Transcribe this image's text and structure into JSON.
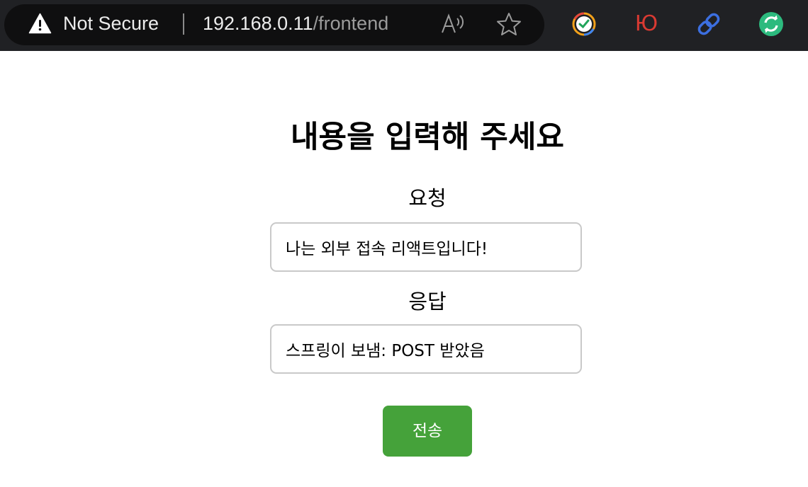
{
  "browser": {
    "security_label": "Not Secure",
    "url_host": "192.168.0.11",
    "url_path": "/frontend",
    "icons": {
      "security": "warning-triangle-icon",
      "read_aloud": "read-aloud-icon",
      "favorite": "star-icon"
    },
    "extensions": [
      {
        "name": "clock-extension-icon"
      },
      {
        "name": "yu-extension-icon",
        "text": "Ю",
        "color": "#d93a32"
      },
      {
        "name": "link-extension-icon",
        "color": "#3c6fe0"
      },
      {
        "name": "refresh-extension-icon",
        "color": "#2cba7e"
      }
    ]
  },
  "form": {
    "heading": "내용을 입력해 주세요",
    "request_label": "요청",
    "request_value": "나는 외부 접속 리액트입니다!",
    "response_label": "응답",
    "response_value": "스프링이 보냄: POST 받았음",
    "submit_label": "전송"
  },
  "colors": {
    "toolbar_background": "#202124",
    "omnibox_background": "#0f0f10",
    "submit_button": "#45a23a",
    "field_border": "#c9c9c9"
  }
}
